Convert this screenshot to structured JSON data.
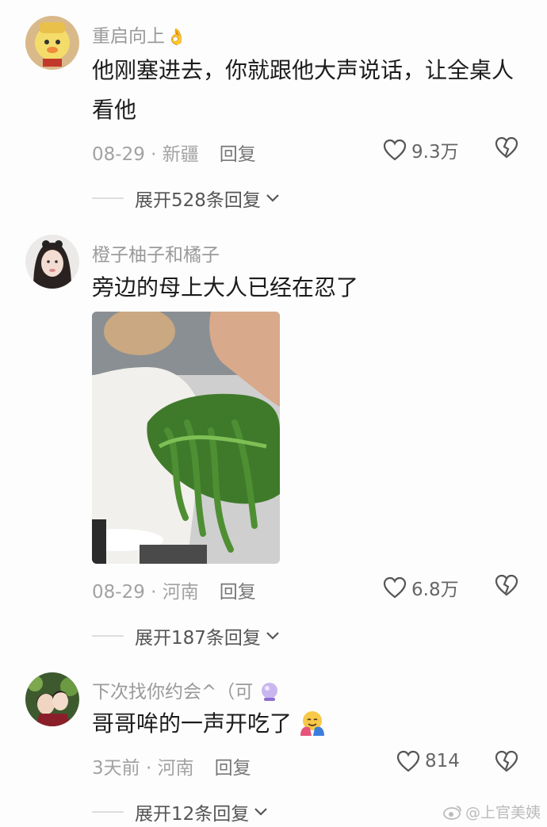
{
  "comments": [
    {
      "username": "重启向上",
      "username_emoji": "👌",
      "text": "他刚塞进去，你就跟他大声说话，让全桌人看他",
      "date": "08-29 · 新疆",
      "reply_label": "回复",
      "likes": "9.3万",
      "expand_label": "展开528条回复"
    },
    {
      "username": "橙子柚子和橘子",
      "text": "旁边的母上大人已经在忍了",
      "date": "08-29 · 河南",
      "reply_label": "回复",
      "likes": "6.8万",
      "expand_label": "展开187条回复"
    },
    {
      "username": "下次找你约会^（可",
      "text": "哥哥哞的一声开吃了",
      "date": "3天前 · 河南",
      "reply_label": "回复",
      "likes": "814",
      "expand_label": "展开12条回复"
    }
  ],
  "watermark": "@上官美姨",
  "colors": {
    "muted": "#9a9a9a",
    "text": "#1c1c1c",
    "icon": "#555555"
  }
}
